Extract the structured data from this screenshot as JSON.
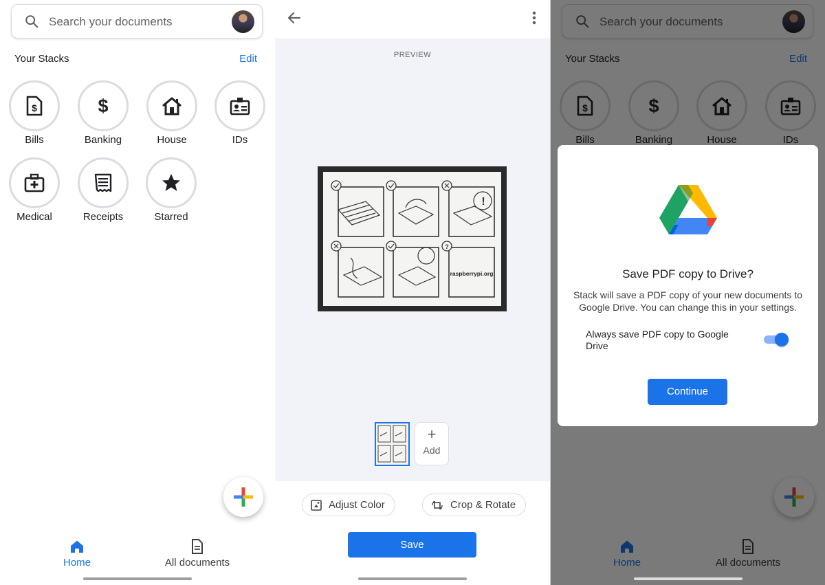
{
  "home": {
    "search_placeholder": "Search your documents",
    "stacks_title": "Your Stacks",
    "edit_label": "Edit",
    "stacks": [
      {
        "label": "Bills",
        "icon": "bill-icon"
      },
      {
        "label": "Banking",
        "icon": "dollar-icon"
      },
      {
        "label": "House",
        "icon": "house-icon"
      },
      {
        "label": "IDs",
        "icon": "id-card-icon"
      },
      {
        "label": "Medical",
        "icon": "medical-kit-icon"
      },
      {
        "label": "Receipts",
        "icon": "receipt-icon"
      },
      {
        "label": "Starred",
        "icon": "star-icon"
      }
    ],
    "nav": {
      "home_label": "Home",
      "all_docs_label": "All documents"
    }
  },
  "preview": {
    "label": "PREVIEW",
    "scan_text": "raspberrypi.org",
    "add_label": "Add",
    "adjust_color_label": "Adjust Color",
    "crop_rotate_label": "Crop & Rotate",
    "save_label": "Save"
  },
  "dialog": {
    "title": "Save PDF copy to Drive?",
    "body": "Stack will save a PDF copy of your new documents to Google Drive. You can change this in your settings.",
    "toggle_label": "Always save PDF copy to Google Drive",
    "toggle_on": true,
    "continue_label": "Continue"
  },
  "colors": {
    "accent": "#1a73e8",
    "drive_green": "#1ea362",
    "drive_yellow": "#ffba00",
    "drive_blue": "#4285f4",
    "fab_red": "#ea4335"
  }
}
